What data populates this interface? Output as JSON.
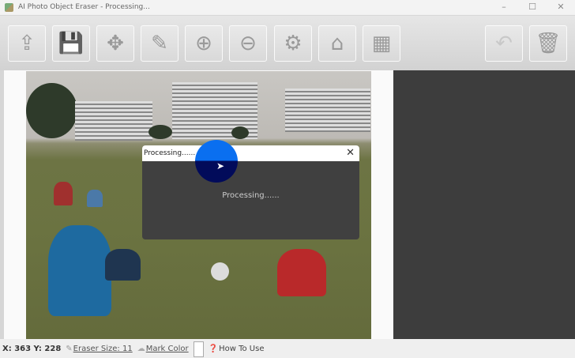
{
  "window": {
    "title": "AI Photo Object Eraser - Processing...",
    "minimize": "–",
    "maximize": "☐",
    "close": "✕"
  },
  "toolbar": {
    "buttons": [
      {
        "name": "open",
        "icon": "⇪"
      },
      {
        "name": "save",
        "icon": "💾"
      },
      {
        "name": "move",
        "icon": "✥"
      },
      {
        "name": "eraser",
        "icon": "✎"
      },
      {
        "name": "zoom-in",
        "icon": "⊕"
      },
      {
        "name": "zoom-out",
        "icon": "⊖"
      },
      {
        "name": "settings",
        "icon": "⚙"
      },
      {
        "name": "home",
        "icon": "⌂"
      },
      {
        "name": "batch",
        "icon": "▦"
      }
    ],
    "right_buttons": [
      {
        "name": "undo",
        "icon": "↶"
      },
      {
        "name": "delete",
        "icon": "🗑"
      }
    ]
  },
  "status": {
    "coords": "X: 363 Y: 228",
    "eraser_size": "Eraser Size: 11",
    "mark_color": "Mark Color",
    "mark_color_value": "#ffffff",
    "how_to_use": "How To Use"
  },
  "dialog": {
    "title": "Processing......",
    "message": "Processing......",
    "close": "✕"
  },
  "colors": {
    "panel": "#3d3d3d",
    "cursor_circle": "#0a6ff0"
  }
}
